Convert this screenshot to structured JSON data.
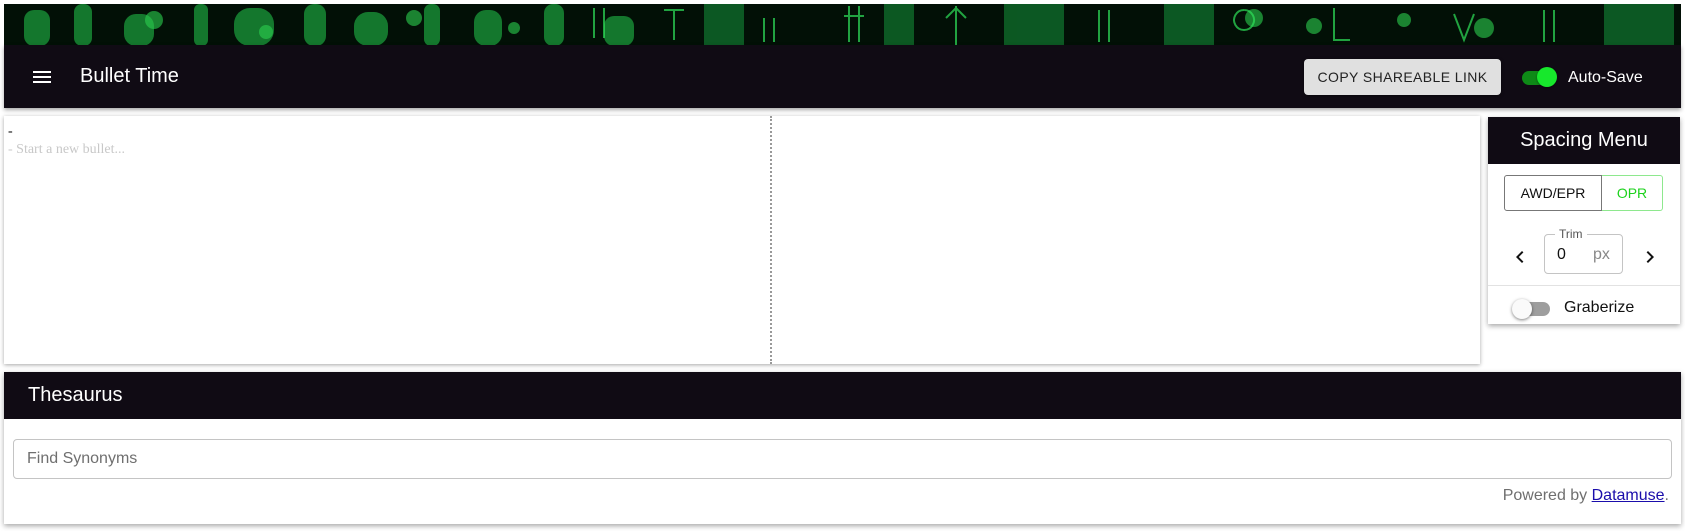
{
  "app": {
    "title": "Bullet Time",
    "copy_link_label": "COPY SHAREABLE LINK",
    "autosave_label": "Auto-Save",
    "autosave_on": true
  },
  "editor": {
    "lines": [
      "-",
      "- Start a new bullet..."
    ]
  },
  "spacing_menu": {
    "title": "Spacing Menu",
    "modes": [
      "AWD/EPR",
      "OPR"
    ],
    "active_mode": "OPR",
    "trim_label": "Trim",
    "trim_value": "0",
    "trim_unit": "px",
    "graberize_label": "Graberize",
    "graberize_on": false
  },
  "thesaurus": {
    "title": "Thesaurus",
    "search_placeholder": "Find Synonyms",
    "powered_by_text": "Powered by ",
    "powered_by_link": "Datamuse",
    "powered_by_suffix": "."
  },
  "colors": {
    "appbar_bg": "#100b14",
    "accent_green": "#17e82c",
    "link_blue": "#1a0dab"
  }
}
